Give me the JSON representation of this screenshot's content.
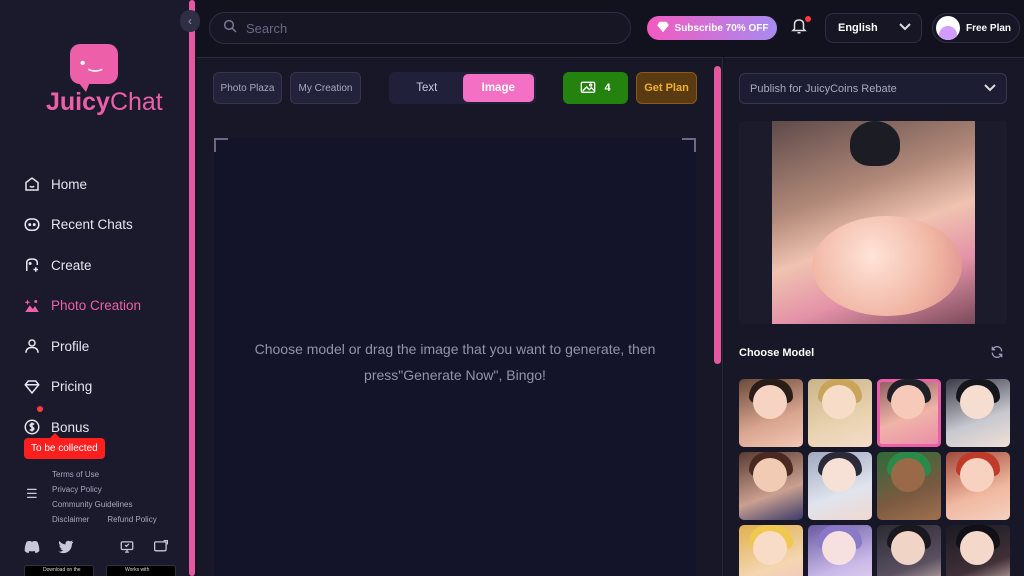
{
  "app": {
    "brand_main": "Juicy",
    "brand_sub": "Chat",
    "colors": {
      "accent": "#ee5fa9",
      "background": "#12121f",
      "credits": "#24820f",
      "get_plan": "#f0b030",
      "badge": "#ff1f1f"
    }
  },
  "sidebar": {
    "items": [
      {
        "label": "Home",
        "icon": "home-icon"
      },
      {
        "label": "Recent Chats",
        "icon": "chat-icon"
      },
      {
        "label": "Create",
        "icon": "create-icon"
      },
      {
        "label": "Photo Creation",
        "icon": "photo-icon",
        "active": true
      },
      {
        "label": "Profile",
        "icon": "user-icon"
      },
      {
        "label": "Pricing",
        "icon": "diamond-icon"
      },
      {
        "label": "Bonus",
        "icon": "dollar-icon"
      }
    ],
    "bonus_badge": "To be collected",
    "footer_links": [
      "Terms of Use",
      "Privacy Policy",
      "Community Guidelines",
      "Disclaimer",
      "Refund Policy"
    ],
    "store_buttons": [
      "Download on the",
      "Works with"
    ]
  },
  "topbar": {
    "search_placeholder": "Search",
    "subscribe_label": "Subscribe 70% OFF",
    "language": "English",
    "plan_label": "Free Plan"
  },
  "main": {
    "chips": [
      "Photo Plaza",
      "My Creation"
    ],
    "mode_tabs": [
      {
        "label": "Text",
        "selected": false
      },
      {
        "label": "Image",
        "selected": true
      }
    ],
    "credits_count": "4",
    "get_plan_label": "Get Plan",
    "drop_hint": "Choose model or drag the image that you want to generate, then press\"Generate Now\", Bingo!"
  },
  "right": {
    "publish_select": "Publish for JuicyCoins Rebate",
    "choose_model_title": "Choose Model",
    "selected_model_index": 2
  }
}
